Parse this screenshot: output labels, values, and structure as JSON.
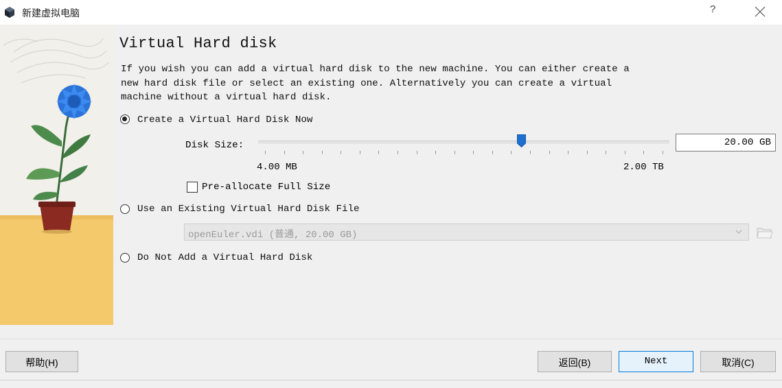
{
  "window": {
    "title": "新建虚拟电脑",
    "help_glyph": "?",
    "close_icon": "close-icon",
    "app_icon": "virtualbox-icon"
  },
  "page": {
    "heading": "Virtual Hard disk",
    "description": "If you wish you can add a virtual hard disk to the new machine. You can either create a\nnew hard disk file or select an existing one. Alternatively you can create a virtual\nmachine without a virtual hard disk."
  },
  "options": {
    "create_now": {
      "label": "Create a Virtual Hard Disk Now",
      "selected": true
    },
    "use_existing": {
      "label": "Use an Existing Virtual Hard Disk File",
      "selected": false
    },
    "no_disk": {
      "label": "Do Not Add a Virtual Hard Disk",
      "selected": false
    }
  },
  "disk_size": {
    "label": "Disk Size:",
    "value": "20.00 GB",
    "min_label": "4.00 MB",
    "max_label": "2.00 TB",
    "slider_fraction": 0.64,
    "tick_count": 22
  },
  "preallocate": {
    "label": "Pre-allocate Full Size",
    "checked": false
  },
  "existing_file": {
    "value": "openEuler.vdi (普通, 20.00 GB)",
    "enabled": false
  },
  "buttons": {
    "help": "帮助(H)",
    "back": "返回(B)",
    "next": "Next",
    "cancel": "取消(C)"
  },
  "colors": {
    "accent": "#0078d7",
    "panel_bg": "#f0f0f0",
    "slider_thumb": "#1e6fd0"
  }
}
